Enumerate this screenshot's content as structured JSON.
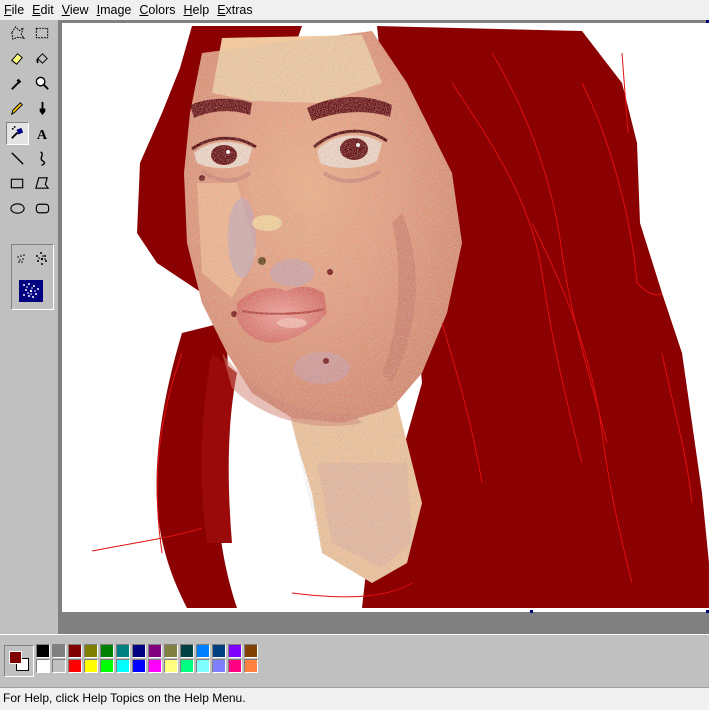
{
  "menu": [
    "File",
    "Edit",
    "View",
    "Image",
    "Colors",
    "Help",
    "Extras"
  ],
  "tools": [
    {
      "name": "free-form-select-icon"
    },
    {
      "name": "rectangle-select-icon"
    },
    {
      "name": "eraser-icon"
    },
    {
      "name": "fill-bucket-icon"
    },
    {
      "name": "color-picker-icon"
    },
    {
      "name": "magnifier-icon"
    },
    {
      "name": "pencil-icon"
    },
    {
      "name": "brush-icon"
    },
    {
      "name": "airbrush-icon",
      "selected": true
    },
    {
      "name": "text-tool-icon",
      "glyph": "A"
    },
    {
      "name": "line-icon"
    },
    {
      "name": "curve-icon"
    },
    {
      "name": "rectangle-icon"
    },
    {
      "name": "polygon-icon"
    },
    {
      "name": "ellipse-icon"
    },
    {
      "name": "rounded-rectangle-icon"
    }
  ],
  "colors": {
    "foreground": "#800000",
    "background": "#ffffff",
    "palette_top": [
      "#000000",
      "#808080",
      "#800000",
      "#808000",
      "#008000",
      "#008080",
      "#000080",
      "#800080",
      "#808040",
      "#004040",
      "#0080ff",
      "#004080",
      "#8000ff",
      "#804000"
    ],
    "palette_bottom": [
      "#ffffff",
      "#c0c0c0",
      "#ff0000",
      "#ffff00",
      "#00ff00",
      "#00ffff",
      "#0000ff",
      "#ff00ff",
      "#ffff80",
      "#00ff80",
      "#80ffff",
      "#8080ff",
      "#ff0080",
      "#ff8040"
    ]
  },
  "status": {
    "text": "For Help, click Help Topics on the Help Menu."
  }
}
